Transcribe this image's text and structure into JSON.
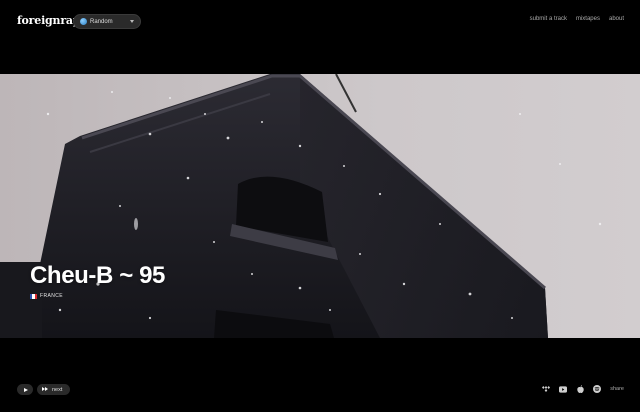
{
  "header": {
    "logo": "foreignrap",
    "mode_select": {
      "value": "Random"
    },
    "nav": [
      "submit a track",
      "mixtapes",
      "about"
    ]
  },
  "track": {
    "title": "Cheu-B ~ 95",
    "country": "FRANCE"
  },
  "player": {
    "play_icon": "play-icon",
    "next_label": "next",
    "platform_icons": [
      "tidal-icon",
      "youtube-icon",
      "apple-icon",
      "spotify-icon"
    ],
    "share_label": "share"
  },
  "colors": {
    "background": "#000000",
    "hero_sky": "#c7c2c4",
    "building": "#1c1c22"
  }
}
